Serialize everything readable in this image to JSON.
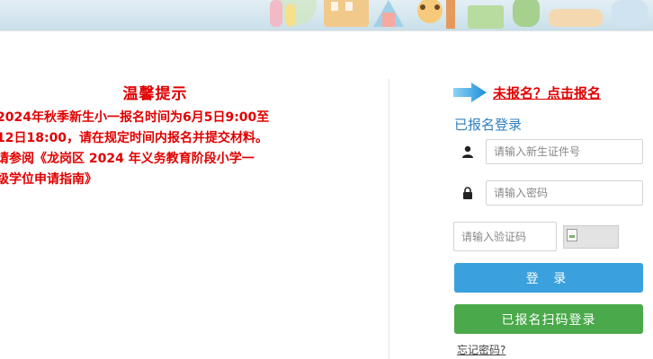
{
  "notice": {
    "title": "温馨提示",
    "lines": [
      "2024年秋季新生小一报名时间为6月5日9:00至",
      "12日18:00，请在规定时间内报名并提交材料。",
      "请参阅《龙岗区 2024 年义务教育阶段小学一",
      "级学位申请指南》"
    ]
  },
  "register": {
    "link_label": "未报名？点击报名",
    "arrow_icon": "arrow-right-icon"
  },
  "login": {
    "title": "已报名登录",
    "id_placeholder": "请输入新生证件号",
    "password_placeholder": "请输入密码",
    "captcha_placeholder": "请输入验证码",
    "login_label": "登 录",
    "scan_label": "已报名扫码登录",
    "forgot_label": "忘记密码?",
    "user_icon": "user-icon",
    "lock_icon": "lock-icon"
  },
  "colors": {
    "notice_red": "#e00000",
    "title_blue": "#2f7fc0",
    "login_button": "#3aa0de",
    "scan_button": "#4aa94a"
  }
}
